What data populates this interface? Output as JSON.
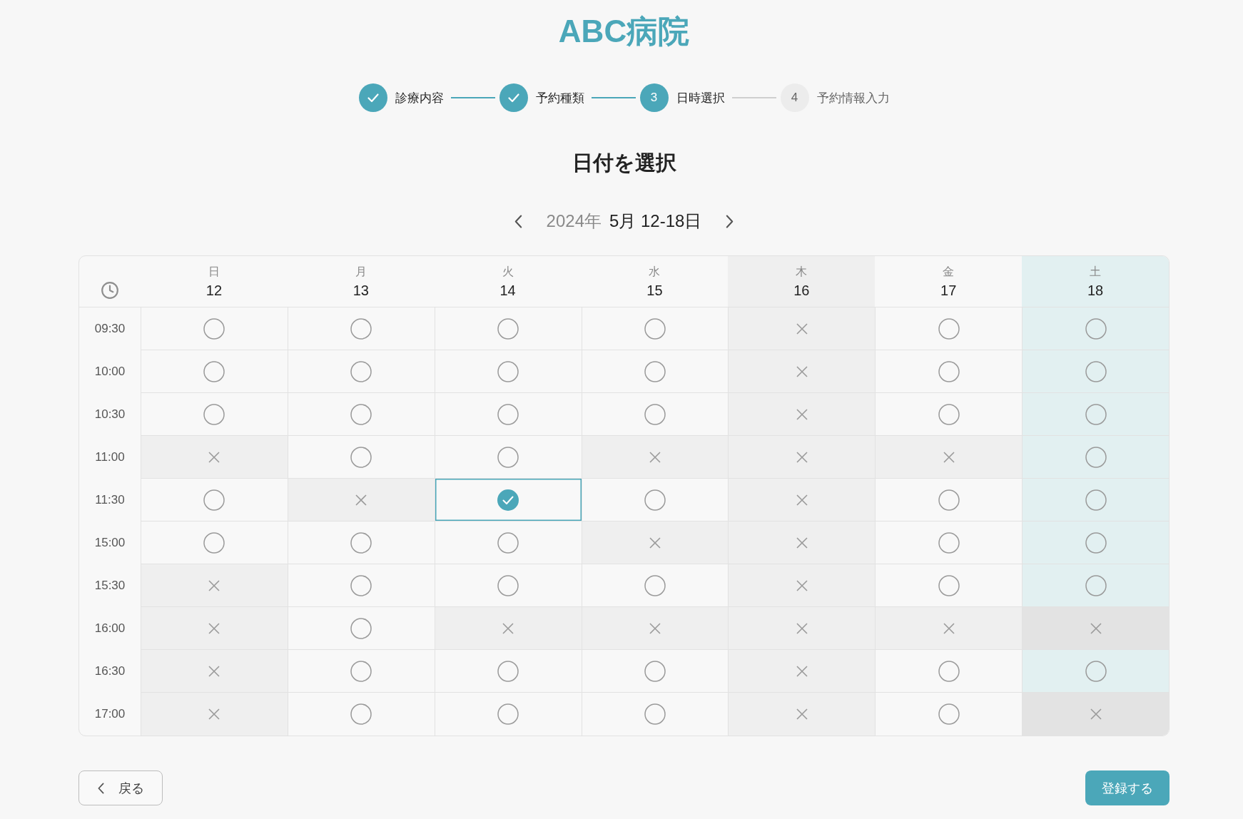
{
  "header": {
    "title": "ABC病院"
  },
  "steps": [
    {
      "label": "診療内容",
      "completed": true,
      "reached": true
    },
    {
      "label": "予約種類",
      "completed": true,
      "reached": true
    },
    {
      "number": "3",
      "label": "日時選択",
      "completed": false,
      "reached": true
    },
    {
      "number": "4",
      "label": "予約情報入力",
      "completed": false,
      "reached": false
    }
  ],
  "heading": "日付を選択",
  "week_nav": {
    "year": "2024年",
    "range": "5月 12-18日"
  },
  "schedule": {
    "days": [
      {
        "weekday": "日",
        "date": "12",
        "kind": "normal"
      },
      {
        "weekday": "月",
        "date": "13",
        "kind": "normal"
      },
      {
        "weekday": "火",
        "date": "14",
        "kind": "normal"
      },
      {
        "weekday": "水",
        "date": "15",
        "kind": "normal"
      },
      {
        "weekday": "木",
        "date": "16",
        "kind": "closed"
      },
      {
        "weekday": "金",
        "date": "17",
        "kind": "normal"
      },
      {
        "weekday": "土",
        "date": "18",
        "kind": "saturday"
      }
    ],
    "rows": [
      {
        "time": "09:30",
        "slots": [
          {
            "available": true,
            "selected": false
          },
          {
            "available": true,
            "selected": false
          },
          {
            "available": true,
            "selected": false
          },
          {
            "available": true,
            "selected": false
          },
          {
            "available": false,
            "selected": false
          },
          {
            "available": true,
            "selected": false
          },
          {
            "available": true,
            "selected": false
          }
        ]
      },
      {
        "time": "10:00",
        "slots": [
          {
            "available": true,
            "selected": false
          },
          {
            "available": true,
            "selected": false
          },
          {
            "available": true,
            "selected": false
          },
          {
            "available": true,
            "selected": false
          },
          {
            "available": false,
            "selected": false
          },
          {
            "available": true,
            "selected": false
          },
          {
            "available": true,
            "selected": false
          }
        ]
      },
      {
        "time": "10:30",
        "slots": [
          {
            "available": true,
            "selected": false
          },
          {
            "available": true,
            "selected": false
          },
          {
            "available": true,
            "selected": false
          },
          {
            "available": true,
            "selected": false
          },
          {
            "available": false,
            "selected": false
          },
          {
            "available": true,
            "selected": false
          },
          {
            "available": true,
            "selected": false
          }
        ]
      },
      {
        "time": "11:00",
        "slots": [
          {
            "available": false,
            "selected": false
          },
          {
            "available": true,
            "selected": false
          },
          {
            "available": true,
            "selected": false
          },
          {
            "available": false,
            "selected": false
          },
          {
            "available": false,
            "selected": false
          },
          {
            "available": false,
            "selected": false
          },
          {
            "available": true,
            "selected": false
          }
        ]
      },
      {
        "time": "11:30",
        "slots": [
          {
            "available": true,
            "selected": false
          },
          {
            "available": false,
            "selected": false
          },
          {
            "available": true,
            "selected": true
          },
          {
            "available": true,
            "selected": false
          },
          {
            "available": false,
            "selected": false
          },
          {
            "available": true,
            "selected": false
          },
          {
            "available": true,
            "selected": false
          }
        ]
      },
      {
        "time": "15:00",
        "slots": [
          {
            "available": true,
            "selected": false
          },
          {
            "available": true,
            "selected": false
          },
          {
            "available": true,
            "selected": false
          },
          {
            "available": false,
            "selected": false
          },
          {
            "available": false,
            "selected": false
          },
          {
            "available": true,
            "selected": false
          },
          {
            "available": true,
            "selected": false
          }
        ]
      },
      {
        "time": "15:30",
        "slots": [
          {
            "available": false,
            "selected": false
          },
          {
            "available": true,
            "selected": false
          },
          {
            "available": true,
            "selected": false
          },
          {
            "available": true,
            "selected": false
          },
          {
            "available": false,
            "selected": false
          },
          {
            "available": true,
            "selected": false
          },
          {
            "available": true,
            "selected": false
          }
        ]
      },
      {
        "time": "16:00",
        "slots": [
          {
            "available": false,
            "selected": false
          },
          {
            "available": true,
            "selected": false
          },
          {
            "available": false,
            "selected": false
          },
          {
            "available": false,
            "selected": false
          },
          {
            "available": false,
            "selected": false
          },
          {
            "available": false,
            "selected": false
          },
          {
            "available": false,
            "selected": false
          }
        ]
      },
      {
        "time": "16:30",
        "slots": [
          {
            "available": false,
            "selected": false
          },
          {
            "available": true,
            "selected": false
          },
          {
            "available": true,
            "selected": false
          },
          {
            "available": true,
            "selected": false
          },
          {
            "available": false,
            "selected": false
          },
          {
            "available": true,
            "selected": false
          },
          {
            "available": true,
            "selected": false
          }
        ]
      },
      {
        "time": "17:00",
        "slots": [
          {
            "available": false,
            "selected": false
          },
          {
            "available": true,
            "selected": false
          },
          {
            "available": true,
            "selected": false
          },
          {
            "available": true,
            "selected": false
          },
          {
            "available": false,
            "selected": false
          },
          {
            "available": true,
            "selected": false
          },
          {
            "available": false,
            "selected": false
          }
        ]
      }
    ]
  },
  "buttons": {
    "back": "戻る",
    "submit": "登録する"
  }
}
